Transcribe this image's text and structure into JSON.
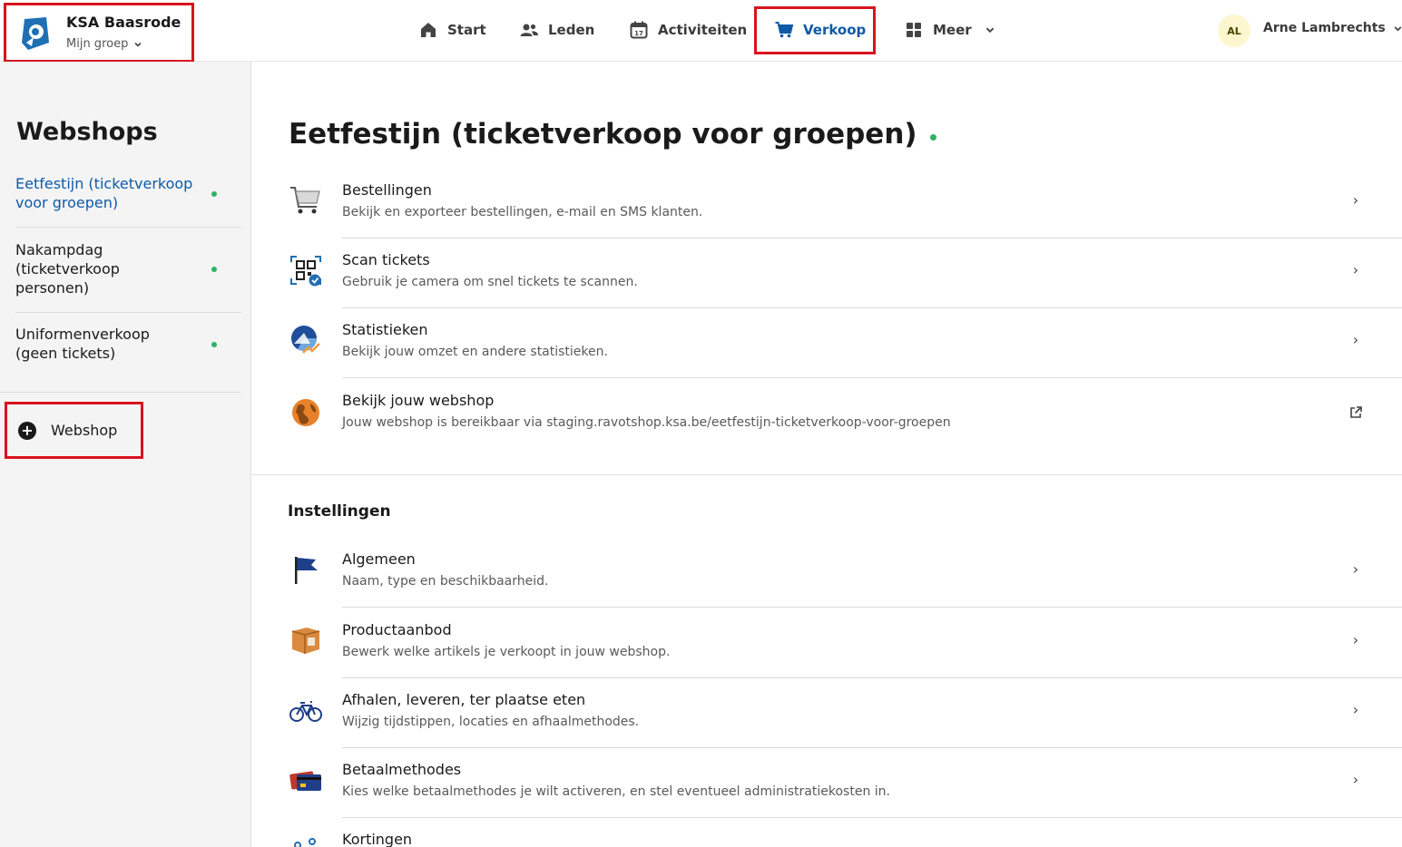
{
  "org": {
    "name": "KSA Baasrode",
    "sub": "Mijn groep"
  },
  "nav": {
    "start": "Start",
    "leden": "Leden",
    "activiteiten": "Activiteiten",
    "verkoop": "Verkoop",
    "meer": "Meer"
  },
  "user": {
    "initials": "AL",
    "name": "Arne Lambrechts"
  },
  "sidebar": {
    "title": "Webshops",
    "items": [
      {
        "label": "Eetfestijn (ticketverkoop voor groepen)"
      },
      {
        "label": "Nakampdag (ticketverkoop personen)"
      },
      {
        "label": "Uniformenverkoop (geen tickets)"
      }
    ],
    "add_label": "Webshop"
  },
  "main": {
    "title": "Eetfestijn (ticketverkoop voor groepen)",
    "rows": [
      {
        "title": "Bestellingen",
        "desc": "Bekijk en exporteer bestellingen, e-mail en SMS klanten."
      },
      {
        "title": "Scan tickets",
        "desc": "Gebruik je camera om snel tickets te scannen."
      },
      {
        "title": "Statistieken",
        "desc": "Bekijk jouw omzet en andere statistieken."
      },
      {
        "title": "Bekijk jouw webshop",
        "desc": "Jouw webshop is bereikbaar via staging.ravotshop.ksa.be/eetfestijn-ticketverkoop-voor-groepen"
      }
    ],
    "settings_title": "Instellingen",
    "settings": [
      {
        "title": "Algemeen",
        "desc": "Naam, type en beschikbaarheid."
      },
      {
        "title": "Productaanbod",
        "desc": "Bewerk welke artikels je verkoopt in jouw webshop."
      },
      {
        "title": "Afhalen, leveren, ter plaatse eten",
        "desc": "Wijzig tijdstippen, locaties en afhaalmethodes."
      },
      {
        "title": "Betaalmethodes",
        "desc": "Kies welke betaalmethodes je wilt activeren, en stel eventueel administratiekosten in."
      },
      {
        "title": "Kortingen",
        "desc": ""
      }
    ]
  },
  "colors": {
    "accent": "#0e5aa7",
    "highlight": "#d8131f",
    "status_ok": "#2cb462"
  }
}
